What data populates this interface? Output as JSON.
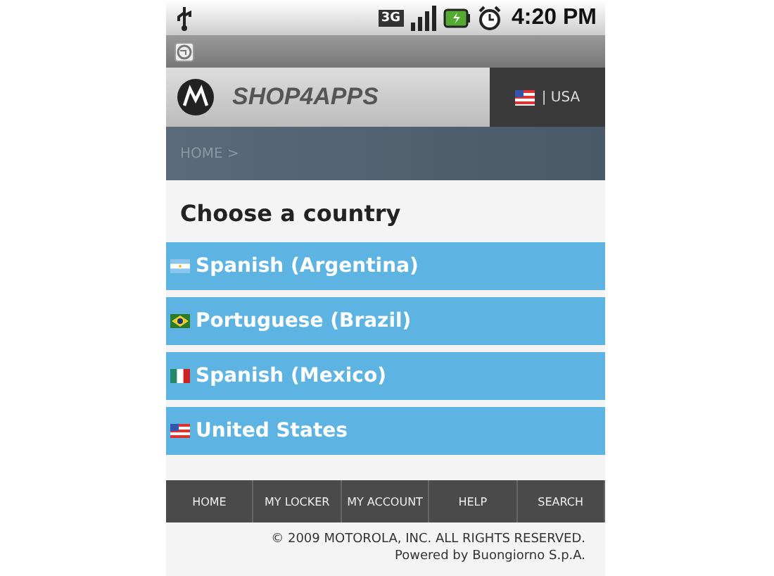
{
  "status_bar": {
    "network_type": "3G",
    "time": "4:20 PM"
  },
  "header": {
    "brand": "SHOP4APPS",
    "kind": "us",
    "country": "| USA"
  },
  "breadcrumb": "HOME >",
  "heading": "Choose a country",
  "countries": [
    {
      "kind": "ar",
      "label": "Spanish (Argentina)"
    },
    {
      "kind": "br",
      "label": "Portuguese (Brazil)"
    },
    {
      "kind": "mx",
      "label": "Spanish (Mexico)"
    },
    {
      "kind": "us",
      "label": "United States"
    }
  ],
  "nav": [
    "HOME",
    "MY LOCKER",
    "MY ACCOUNT",
    "HELP",
    "SEARCH"
  ],
  "footer": [
    "© 2009 MOTOROLA, INC. ALL RIGHTS RESERVED.",
    "Powered by Buongiorno S.p.A."
  ]
}
